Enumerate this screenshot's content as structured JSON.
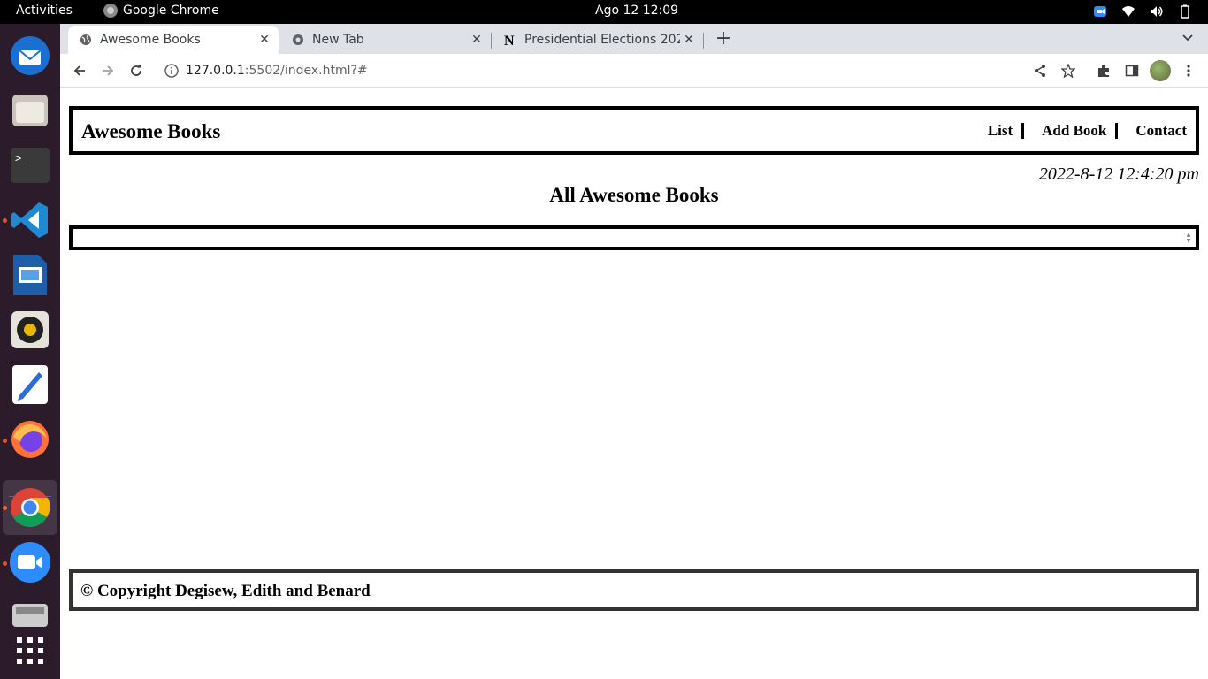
{
  "system": {
    "activities": "Activities",
    "app_name": "Google Chrome",
    "clock": "Ago 12  12:09"
  },
  "dock": {
    "items": [
      {
        "name": "thunderbird"
      },
      {
        "name": "files"
      },
      {
        "name": "terminal"
      },
      {
        "name": "vscode"
      },
      {
        "name": "libreoffice-impress"
      },
      {
        "name": "rhythmbox"
      },
      {
        "name": "text-editor"
      },
      {
        "name": "firefox"
      },
      {
        "name": "chrome"
      },
      {
        "name": "zoom"
      },
      {
        "name": "removable-drive"
      },
      {
        "name": "show-apps"
      }
    ]
  },
  "browser": {
    "tabs": [
      {
        "title": "Awesome Books",
        "close": "✕"
      },
      {
        "title": "New Tab",
        "close": "✕"
      },
      {
        "title": "Presidential Elections 202",
        "close": "✕"
      }
    ],
    "new_tab": "+",
    "url_host": "127.0.0.1",
    "url_path": ":5502/index.html?#"
  },
  "page": {
    "brand": "Awesome Books",
    "nav": [
      "List",
      "Add Book",
      "Contact"
    ],
    "datetime": "2022-8-12 12:4:20 pm",
    "section_title": "All Awesome Books",
    "footer": "© Copyright Degisew, Edith and Benard"
  }
}
